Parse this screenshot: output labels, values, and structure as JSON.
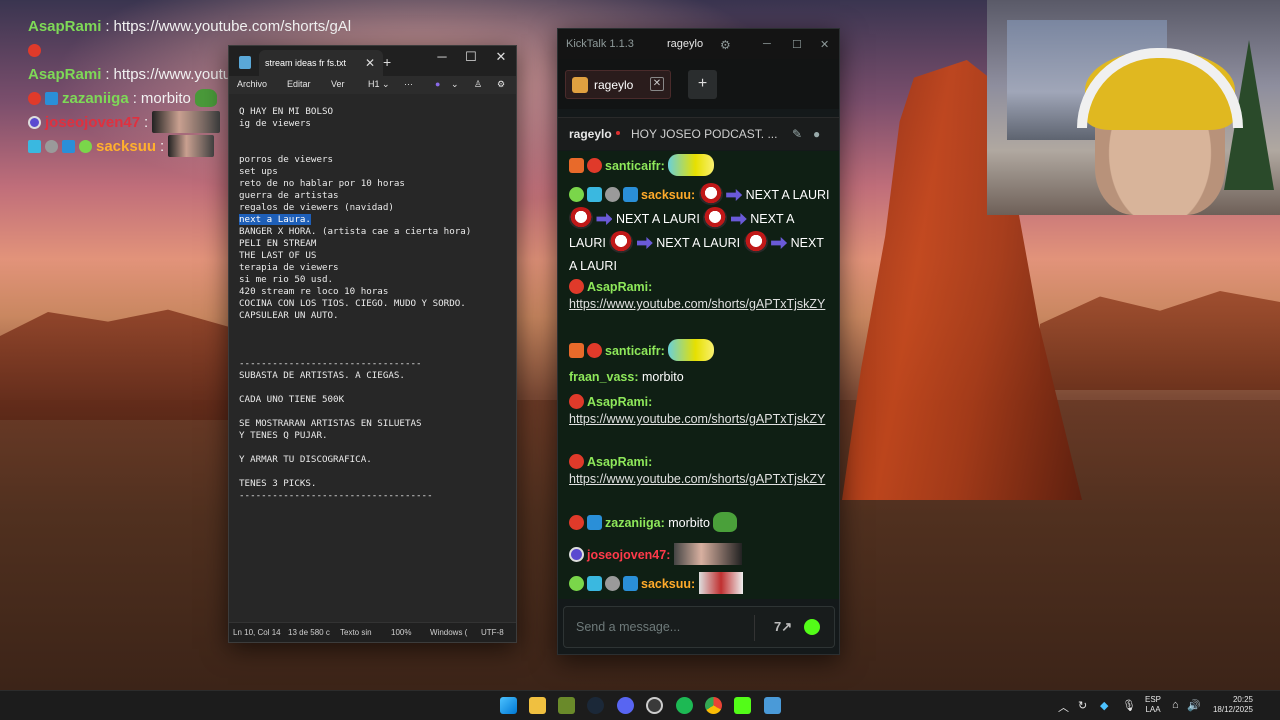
{
  "overlay_chat": [
    {
      "user": "AsapRami",
      "text": "https://www.youtube.com/shorts/gAl"
    },
    {
      "user": "",
      "text": ""
    },
    {
      "user": "AsapRami",
      "text": "https://www.youtube.com/shorts/gAl"
    },
    {
      "user": "zazaniiga",
      "text": "morbito"
    },
    {
      "user": "joseojoven47",
      "text": ""
    },
    {
      "user": "sacksuu",
      "text": ""
    }
  ],
  "notepad": {
    "tab_title": "stream ideas fr fs.txt",
    "menu": [
      "Archivo",
      "Editar",
      "Ver"
    ],
    "heading_menu": "H1",
    "more": "···",
    "lines": [
      "Q HAY EN MI BOLSO",
      "ig de viewers",
      "",
      "",
      "porros de viewers",
      "set ups",
      "reto de no hablar por 10 horas",
      "guerra de artistas",
      "regalos de viewers (navidad)",
      "next a Laura.",
      "BANGER X HORA. (artista cae a cierta hora)",
      "PELI EN STREAM",
      "THE LAST OF US",
      "terapia de viewers",
      "si me rio 50 usd.",
      "420 stream re loco 10 horas",
      "COCINA CON LOS TIOS. CIEGO. MUDO Y SORDO.",
      "CAPSULEAR UN AUTO.",
      "",
      "",
      "",
      "---------------------------------",
      "SUBASTA DE ARTISTAS. A CIEGAS.",
      "",
      "CADA UNO TIENE 500K",
      "",
      "SE MOSTRARAN ARTISTAS EN SILUETAS",
      "Y TENES Q PUJAR.",
      "",
      "Y ARMAR TU DISCOGRAFICA.",
      "",
      "TENES 3 PICKS.",
      "-----------------------------------"
    ],
    "selected_line_index": 9,
    "status": {
      "position": "Ln 10, Col 14",
      "chars": "13 de 580 c",
      "format": "Texto sin",
      "zoom": "100%",
      "line_ending": "Windows (",
      "encoding": "UTF-8"
    }
  },
  "kicktalk": {
    "app_title": "KickTalk 1.1.3",
    "account": "rageylo",
    "tab_label": "rageylo",
    "streamer": "rageylo",
    "stream_title": "HOY JOSEO PODCAST. ...",
    "messages": {
      "m1_user": "santicaifr:",
      "m2_user": "sacksuu:",
      "m2_a": "NEXT A LAURI",
      "m2_b": "NEXT A LAURI",
      "m2_c": "NEXT A LAURI",
      "m2_d": "NEXT A LAURI",
      "m2_e": "NEXT A LAURI",
      "m3_user": "AsapRami:",
      "m3_text": "https://www.youtube.com/shorts/gAPTxTjskZY",
      "m4_user": "santicaifr:",
      "m5_user": "fraan_vass:",
      "m5_text": "morbito",
      "m6_user": "AsapRami:",
      "m6_text": "https://www.youtube.com/shorts/gAPTxTjskZY",
      "m7_user": "AsapRami:",
      "m7_text": "https://www.youtube.com/shorts/gAPTxTjskZY",
      "m8_user": "zazaniiga:",
      "m8_text": "morbito",
      "m9_user": "joseojoven47:",
      "m10_user": "sacksuu:"
    },
    "input_placeholder": "Send a message..."
  },
  "taskbar": {
    "lang_top": "ESP",
    "lang_bottom": "LAA",
    "time": "20:25",
    "date": "18/12/2025"
  },
  "colors": {
    "kick_green": "#53fc18",
    "selection": "#1e5fb8"
  }
}
